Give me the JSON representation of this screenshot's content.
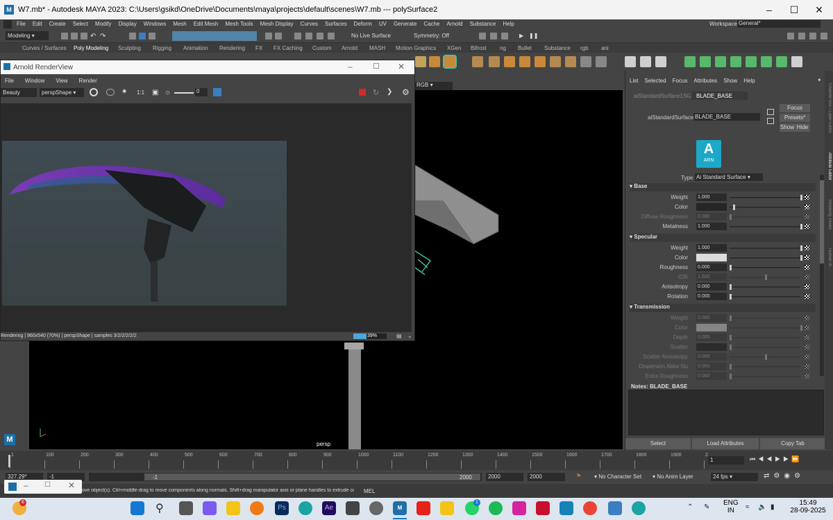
{
  "window": {
    "title": "W7.mb* - Autodesk MAYA 2023: C:\\Users\\gsikd\\OneDrive\\Documents\\maya\\projects\\default\\scenes\\W7.mb   ---   polySurface2",
    "logo": "M"
  },
  "menubar": {
    "items": [
      "File",
      "Edit",
      "Create",
      "Select",
      "Modify",
      "Display",
      "Windows",
      "Mesh",
      "Edit Mesh",
      "Mesh Tools",
      "Mesh Display",
      "Curves",
      "Surfaces",
      "Deform",
      "UV",
      "Generate",
      "Cache",
      "Arnold",
      "Substance",
      "Help"
    ],
    "workspace_label": "Workspace:",
    "workspace_value": "General*"
  },
  "statusline": {
    "mode": "Modeling",
    "live_surface": "No Live Surface",
    "symmetry": "Symmetry: Off"
  },
  "shelf_tabs": [
    "Curves / Surfaces",
    "Poly Modeling",
    "Sculpting",
    "Rigging",
    "Animation",
    "Rendering",
    "FX",
    "FX Caching",
    "Custom",
    "Arnold",
    "MASH",
    "Motion Graphics",
    "XGen",
    "Bifrost",
    "ng",
    "Bullet",
    "Substance",
    "rgb",
    "ani"
  ],
  "render_view": {
    "title": "Arnold RenderView",
    "menu": [
      "File",
      "Window",
      "View",
      "Render"
    ],
    "aov": "Beauty",
    "camera": "perspShape",
    "ratio": "1:1",
    "exposure": "0",
    "status": "Rendering | 960x540 (70%) | perspShape | samples 3/2/2/2/2/2",
    "progress_label": "39%",
    "progress": 0.39
  },
  "viewport": {
    "camera_label": "persp",
    "channel_label": "RGB"
  },
  "attribute_editor": {
    "menu": [
      "List",
      "Selected",
      "Focus",
      "Attributes",
      "Show",
      "Help"
    ],
    "tabs": [
      "aiStandardSurface1SG",
      "BLADE_BASE"
    ],
    "node_type_label": "aiStandardSurface:",
    "node_name": "BLADE_BASE",
    "focus_btn": "Focus",
    "presets_btn": "Presets*",
    "show_btn": "Show",
    "hide_btn": "Hide",
    "arn_label": "ARN",
    "type_label": "Type",
    "type_value": "Ai Standard Surface",
    "sections": [
      {
        "title": "Base",
        "rows": [
          {
            "label": "Weight",
            "value": "1.000",
            "pos": 1.0,
            "dim": false
          },
          {
            "label": "Color",
            "value": "",
            "pos": 0.05,
            "dim": false,
            "swatch": "#262626"
          },
          {
            "label": "Diffuse Roughness",
            "value": "0.000",
            "pos": 0.0,
            "dim": true
          },
          {
            "label": "Metalness",
            "value": "1.000",
            "pos": 1.0,
            "dim": false
          }
        ]
      },
      {
        "title": "Specular",
        "rows": [
          {
            "label": "Weight",
            "value": "1.000",
            "pos": 1.0,
            "dim": false
          },
          {
            "label": "Color",
            "value": "",
            "pos": 1.0,
            "dim": false,
            "swatch": "#dcdcdc"
          },
          {
            "label": "Roughness",
            "value": "0.000",
            "pos": 0.0,
            "dim": false
          },
          {
            "label": "IOR",
            "value": "1.500",
            "pos": 0.5,
            "dim": true
          },
          {
            "label": "Anisotropy",
            "value": "0.000",
            "pos": 0.0,
            "dim": false
          },
          {
            "label": "Rotation",
            "value": "0.000",
            "pos": 0.0,
            "dim": false
          }
        ]
      },
      {
        "title": "Transmission",
        "rows": [
          {
            "label": "Weight",
            "value": "0.000",
            "pos": 0.0,
            "dim": true
          },
          {
            "label": "Color",
            "value": "",
            "pos": 1.0,
            "dim": true,
            "swatch": "#ffffff"
          },
          {
            "label": "Depth",
            "value": "0.000",
            "pos": 0.0,
            "dim": true
          },
          {
            "label": "Scatter",
            "value": "",
            "pos": 0.0,
            "dim": true,
            "swatch": "#000000"
          },
          {
            "label": "Scatter Anisotropy",
            "value": "0.000",
            "pos": 0.5,
            "dim": true
          },
          {
            "label": "Dispersion Abbe Nu",
            "value": "0.000",
            "pos": 0.0,
            "dim": true
          },
          {
            "label": "Extra Roughness",
            "value": "0.000",
            "pos": 0.0,
            "dim": true
          }
        ]
      }
    ],
    "notes_label": "Notes: BLADE_BASE",
    "select_btn": "Select",
    "load_attr_btn": "Load Attributes",
    "copy_tab_btn": "Copy Tab",
    "side_tabs": [
      "Channel Box / Layer Editor",
      "Attribute Editor",
      "Modeling Toolkit",
      "Human IK"
    ]
  },
  "timeline": {
    "ticks": [
      "1",
      "100",
      "200",
      "300",
      "400",
      "500",
      "600",
      "700",
      "800",
      "900",
      "1000",
      "1100",
      "1200",
      "1300",
      "1400",
      "1500",
      "1600",
      "1700",
      "1800",
      "1900",
      "2"
    ],
    "current_frame": "1"
  },
  "range": {
    "field_a": "327.29*",
    "field_b": "-1",
    "slider_start": "-1",
    "slider_end": "2000",
    "end_a": "2000",
    "end_b": "2000",
    "character_set": "No Character Set",
    "anim_layer": "No Anim Layer",
    "fps": "24 fps"
  },
  "helpline": {
    "text": "ove object(s). Ctrl+middle-drag to move components along normals. Shift+drag manipulator axis or plane handles to extrude components or c",
    "mel_label": "MEL"
  },
  "taskbar": {
    "lang": "ENG",
    "region": "IN",
    "time": "15:49",
    "date": "28-09-2025",
    "notif_count": "6",
    "whatsapp_count": "1"
  },
  "colors": {
    "maya_blue": "#1e6fa8",
    "highlight_green": "#41c6a8",
    "render_red": "#d22a2a",
    "progress_blue": "#4fa6d8"
  }
}
